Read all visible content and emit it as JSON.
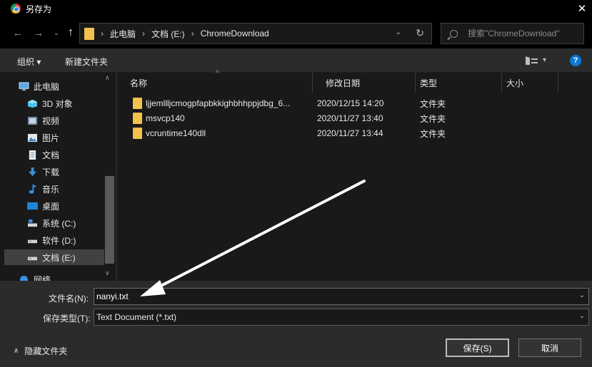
{
  "window": {
    "title": "另存为",
    "close_glyph": "✕"
  },
  "nav": {
    "back": "←",
    "forward": "→",
    "recent": "⌄",
    "up": "↑"
  },
  "address": {
    "crumbs": [
      "此电脑",
      "文档 (E:)",
      "ChromeDownload"
    ],
    "separator": "›",
    "dropdown": "⌄",
    "refresh": "↻"
  },
  "search": {
    "placeholder": "搜索\"ChromeDownload\""
  },
  "toolbar": {
    "organize": "组织 ▾",
    "new_folder": "新建文件夹",
    "view_dropdown": "▾",
    "help": "?"
  },
  "sidebar": {
    "items": [
      {
        "label": "此电脑",
        "icon": "computer-icon"
      },
      {
        "label": "3D 对象",
        "icon": "3d-objects-icon"
      },
      {
        "label": "视频",
        "icon": "videos-icon"
      },
      {
        "label": "图片",
        "icon": "pictures-icon"
      },
      {
        "label": "文档",
        "icon": "documents-icon"
      },
      {
        "label": "下载",
        "icon": "downloads-icon"
      },
      {
        "label": "音乐",
        "icon": "music-icon"
      },
      {
        "label": "桌面",
        "icon": "desktop-icon"
      },
      {
        "label": "系统 (C:)",
        "icon": "drive-c-icon"
      },
      {
        "label": "软件 (D:)",
        "icon": "drive-d-icon"
      },
      {
        "label": "文档 (E:)",
        "icon": "drive-e-icon"
      },
      {
        "label": "网络",
        "icon": "network-icon"
      }
    ],
    "selected": "文档 (E:)",
    "scroll_up": "∧",
    "scroll_down": "∨"
  },
  "columns": {
    "name": "名称",
    "date": "修改日期",
    "type": "类型",
    "size": "大小",
    "sort_indicator": "^"
  },
  "files": [
    {
      "name": "ljjemllljcmogpfapbkkighbhhppjdbg_6...",
      "date": "2020/12/15 14:20",
      "type": "文件夹"
    },
    {
      "name": "msvcp140",
      "date": "2020/11/27 13:40",
      "type": "文件夹"
    },
    {
      "name": "vcruntime140dll",
      "date": "2020/11/27 13:44",
      "type": "文件夹"
    }
  ],
  "form": {
    "filename_label": "文件名(N):",
    "filename_value": "nanyi.txt",
    "filetype_label": "保存类型(T):",
    "filetype_value": "Text Document (*.txt)",
    "dropdown": "⌄"
  },
  "footer": {
    "hide_folders": "隐藏文件夹",
    "hide_chevron": "∧",
    "save": "保存(S)",
    "cancel": "取消"
  },
  "colors": {
    "background": "#191919",
    "chrome": "#000000",
    "panel": "#2b2b2b",
    "folder": "#f2c14e",
    "accent": "#0a78d7",
    "annotation_arrow": "#ffffff"
  }
}
